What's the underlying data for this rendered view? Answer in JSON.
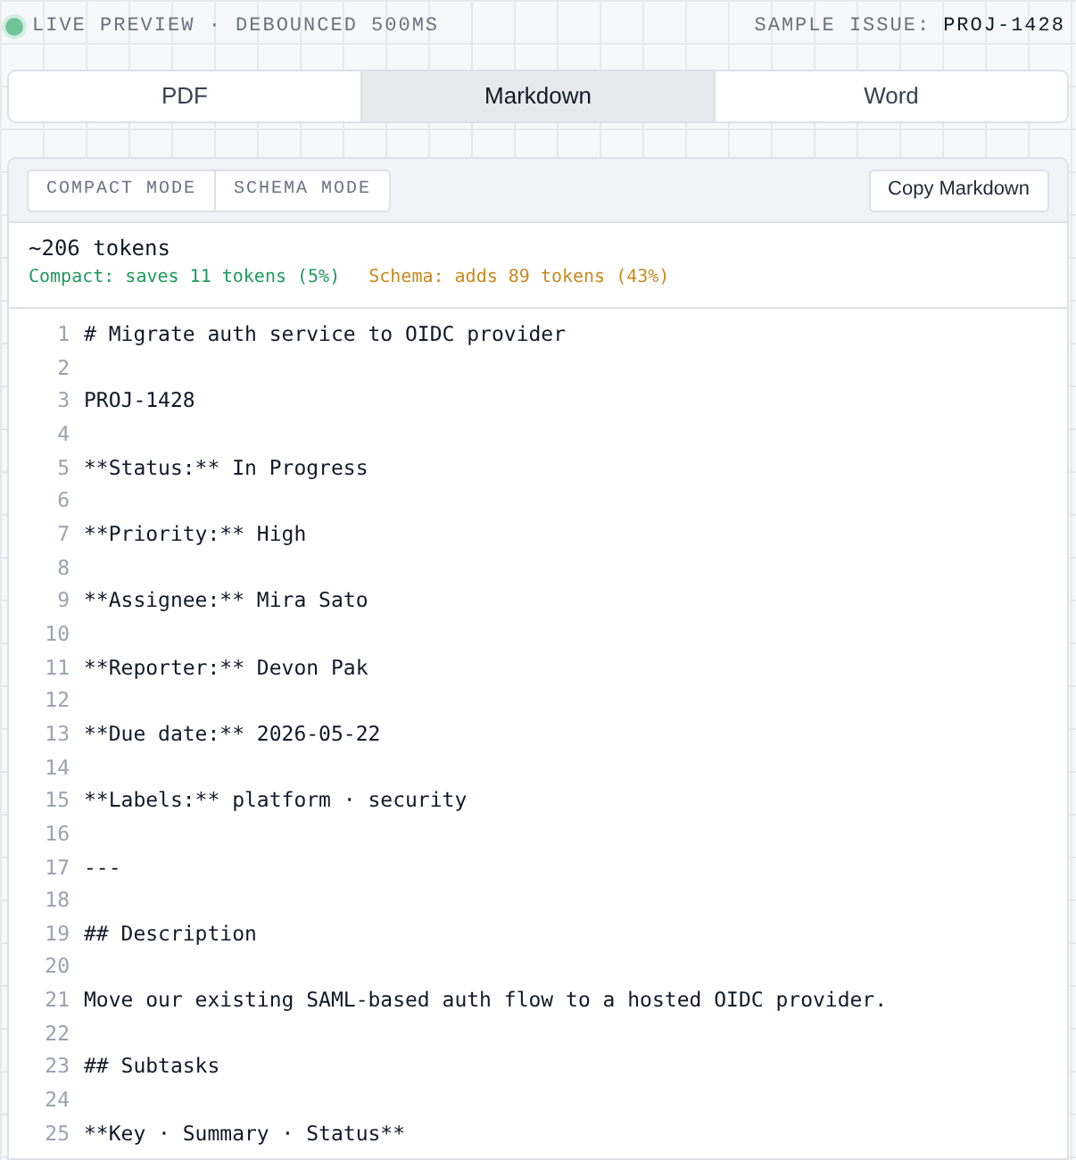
{
  "status_bar": {
    "live": true,
    "label": "LIVE PREVIEW · DEBOUNCED 500MS",
    "issue_label": "SAMPLE ISSUE:",
    "issue_key": "PROJ-1428"
  },
  "tabs": [
    {
      "label": "PDF",
      "selected": false
    },
    {
      "label": "Markdown",
      "selected": true
    },
    {
      "label": "Word",
      "selected": false
    }
  ],
  "toolbar": {
    "modes": [
      {
        "label": "COMPACT MODE",
        "on": false
      },
      {
        "label": "SCHEMA MODE",
        "on": false
      }
    ],
    "copy_button": "Copy Markdown"
  },
  "stats": {
    "tokens": "~206 tokens",
    "compact": "Compact: saves 11 tokens (5%)",
    "schema": "Schema: adds 89 tokens (43%)"
  },
  "code_lines": [
    {
      "number": "1",
      "text": "# Migrate auth service to OIDC provider"
    },
    {
      "number": "2"
    },
    {
      "number": "3",
      "text": "PROJ-1428"
    },
    {
      "number": "4"
    },
    {
      "number": "5",
      "text": "**Status:** In Progress"
    },
    {
      "number": "6"
    },
    {
      "number": "7",
      "text": "**Priority:** High"
    },
    {
      "number": "8"
    },
    {
      "number": "9",
      "text": "**Assignee:** Mira Sato"
    },
    {
      "number": "10"
    },
    {
      "number": "11",
      "text": "**Reporter:** Devon Pak"
    },
    {
      "number": "12"
    },
    {
      "number": "13",
      "text": "**Due date:** 2026-05-22"
    },
    {
      "number": "14"
    },
    {
      "number": "15",
      "text": "**Labels:** platform · security"
    },
    {
      "number": "16"
    },
    {
      "number": "17",
      "text": "---"
    },
    {
      "number": "18"
    },
    {
      "number": "19",
      "text": "## Description"
    },
    {
      "number": "20"
    },
    {
      "number": "21",
      "text": "Move our existing SAML-based auth flow to a hosted OIDC provider."
    },
    {
      "number": "22"
    },
    {
      "number": "23",
      "text": "## Subtasks"
    },
    {
      "number": "24"
    },
    {
      "number": "25",
      "text": "**Key · Summary · Status**"
    }
  ]
}
